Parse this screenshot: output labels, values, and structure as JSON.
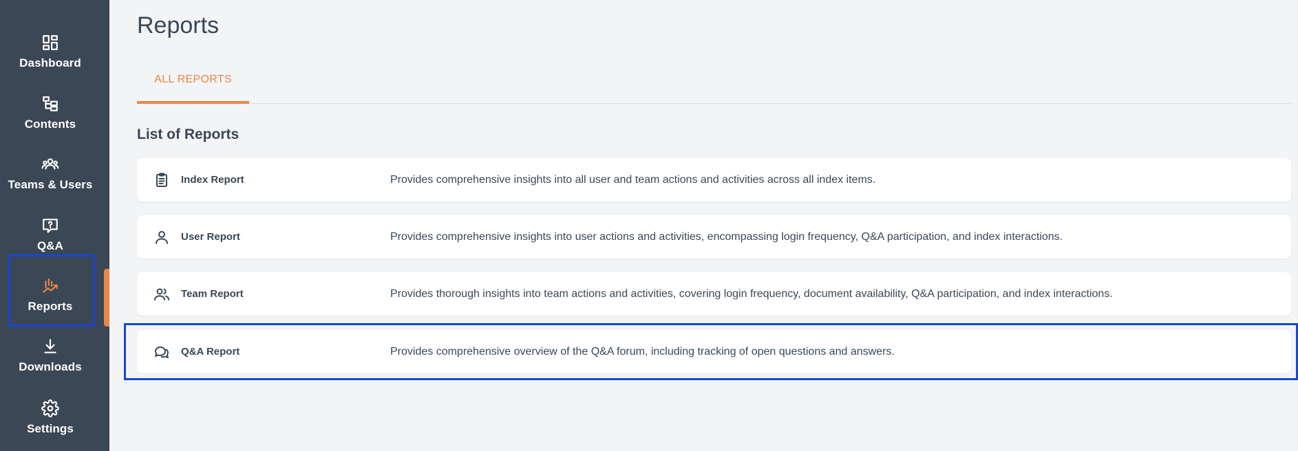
{
  "sidebar": {
    "items": [
      {
        "label": "Dashboard",
        "icon": "dashboard-icon"
      },
      {
        "label": "Contents",
        "icon": "contents-icon"
      },
      {
        "label": "Teams & Users",
        "icon": "teams-users-icon"
      },
      {
        "label": "Q&A",
        "icon": "qa-icon"
      },
      {
        "label": "Reports",
        "icon": "reports-icon",
        "active": true
      },
      {
        "label": "Downloads",
        "icon": "download-icon"
      },
      {
        "label": "Settings",
        "icon": "gear-icon"
      }
    ]
  },
  "page": {
    "title": "Reports",
    "tabs": [
      {
        "label": "ALL REPORTS",
        "active": true
      }
    ],
    "section_title": "List of Reports"
  },
  "reports": [
    {
      "name": "Index Report",
      "icon": "clipboard-icon",
      "description": "Provides comprehensive insights into all user and team actions and activities across all index items."
    },
    {
      "name": "User Report",
      "icon": "user-icon",
      "description": "Provides comprehensive insights into user actions and activities, encompassing login frequency, Q&A participation, and index interactions."
    },
    {
      "name": "Team Report",
      "icon": "team-icon",
      "description": "Provides thorough insights into team actions and activities, covering login frequency, document availability, Q&A participation, and index interactions."
    },
    {
      "name": "Q&A Report",
      "icon": "chat-icon",
      "description": "Provides comprehensive overview of the Q&A forum, including tracking of open questions and answers."
    }
  ],
  "colors": {
    "sidebar_bg": "#3b4754",
    "accent": "#e88748",
    "highlight_box": "#1746d6",
    "page_bg": "#f3f4f6"
  }
}
